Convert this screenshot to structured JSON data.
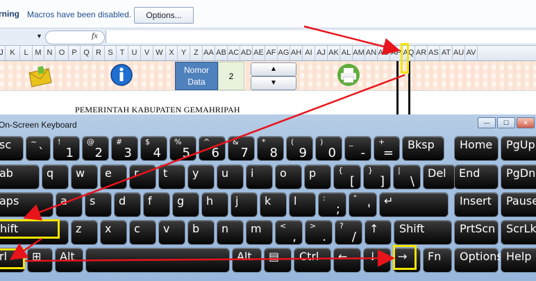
{
  "security_bar": {
    "warning_label": "rning",
    "message": "Macros have been disabled.",
    "options_button": "Options..."
  },
  "formula_bar": {
    "fx_label": "fx",
    "dropdown_glyph": "▼"
  },
  "columns": [
    "J",
    "K",
    "L",
    "M",
    "N",
    "O",
    "P",
    "Q",
    "R",
    "S",
    "T",
    "U",
    "V",
    "W",
    "X",
    "Y",
    "Z",
    "AA",
    "AB",
    "AC",
    "AD",
    "AE",
    "AF",
    "AG",
    "AH",
    "AI",
    "AJ",
    "AK",
    "AL",
    "AM",
    "AN",
    "AO",
    "AP",
    "AQ",
    "AR",
    "AS",
    "AT",
    "AU",
    "AV"
  ],
  "sheet": {
    "nomor_label_line1": "Nomor",
    "nomor_label_line2": "Data",
    "nomor_value": "2",
    "spin_up": "▲",
    "spin_down": "▼",
    "gov_text": "PEMERINTAH KABUPATEN GEMAHRIPAH"
  },
  "osk": {
    "title": "On-Screen Keyboard",
    "win_min": "—",
    "win_max": "☐",
    "win_close": "✕",
    "rows": [
      [
        {
          "id": "esc",
          "label": "sc"
        },
        {
          "id": "tilde",
          "top": "~",
          "bottom": "`"
        },
        {
          "id": "k1",
          "top": "!",
          "bottom": "1"
        },
        {
          "id": "k2",
          "top": "@",
          "bottom": "2"
        },
        {
          "id": "k3",
          "top": "#",
          "bottom": "3"
        },
        {
          "id": "k4",
          "top": "$",
          "bottom": "4"
        },
        {
          "id": "k5",
          "top": "%",
          "bottom": "5"
        },
        {
          "id": "k6",
          "top": "^",
          "bottom": "6"
        },
        {
          "id": "k7",
          "top": "&",
          "bottom": "7"
        },
        {
          "id": "k8",
          "top": "*",
          "bottom": "8"
        },
        {
          "id": "k9",
          "top": "(",
          "bottom": "9"
        },
        {
          "id": "k0",
          "top": ")",
          "bottom": "0"
        },
        {
          "id": "minus",
          "top": "_",
          "bottom": "-"
        },
        {
          "id": "equal",
          "top": "+",
          "bottom": "="
        },
        {
          "id": "bksp",
          "label": "Bksp"
        },
        {
          "id": "home",
          "label": "Home"
        },
        {
          "id": "pgup",
          "label": "PgUp"
        }
      ],
      [
        {
          "id": "tab",
          "label": "ab"
        },
        {
          "id": "q",
          "label": "q"
        },
        {
          "id": "w",
          "label": "w"
        },
        {
          "id": "e",
          "label": "e"
        },
        {
          "id": "r",
          "label": "r"
        },
        {
          "id": "t",
          "label": "t"
        },
        {
          "id": "y",
          "label": "y"
        },
        {
          "id": "u",
          "label": "u"
        },
        {
          "id": "i",
          "label": "i"
        },
        {
          "id": "o",
          "label": "o"
        },
        {
          "id": "p",
          "label": "p"
        },
        {
          "id": "lbrace",
          "top": "{",
          "bottom": "["
        },
        {
          "id": "rbrace",
          "top": "}",
          "bottom": "]"
        },
        {
          "id": "pipe",
          "top": "|",
          "bottom": "\\"
        },
        {
          "id": "del",
          "label": "Del"
        },
        {
          "id": "end",
          "label": "End"
        },
        {
          "id": "pgdn",
          "label": "PgDn"
        }
      ],
      [
        {
          "id": "caps",
          "label": "aps"
        },
        {
          "id": "a",
          "label": "a"
        },
        {
          "id": "s",
          "label": "s"
        },
        {
          "id": "d",
          "label": "d"
        },
        {
          "id": "f",
          "label": "f"
        },
        {
          "id": "g",
          "label": "g"
        },
        {
          "id": "h",
          "label": "h"
        },
        {
          "id": "j",
          "label": "j"
        },
        {
          "id": "k",
          "label": "k"
        },
        {
          "id": "l",
          "label": "l"
        },
        {
          "id": "semicolon",
          "top": ":",
          "bottom": ";"
        },
        {
          "id": "quote",
          "top": "\"",
          "bottom": "'"
        },
        {
          "id": "enter",
          "label": "↵"
        },
        {
          "id": "insert",
          "label": "Insert"
        },
        {
          "id": "pause",
          "label": "Pause"
        }
      ],
      [
        {
          "id": "lshift",
          "label": "hift"
        },
        {
          "id": "z",
          "label": "z"
        },
        {
          "id": "x",
          "label": "x"
        },
        {
          "id": "c",
          "label": "c"
        },
        {
          "id": "v",
          "label": "v"
        },
        {
          "id": "b",
          "label": "b"
        },
        {
          "id": "n",
          "label": "n"
        },
        {
          "id": "m",
          "label": "m"
        },
        {
          "id": "comma",
          "top": "<",
          "bottom": ","
        },
        {
          "id": "period",
          "top": ">",
          "bottom": "."
        },
        {
          "id": "slash",
          "top": "?",
          "bottom": "/"
        },
        {
          "id": "up",
          "label": "↑"
        },
        {
          "id": "rshift",
          "label": "Shift"
        },
        {
          "id": "prtscn",
          "label": "PrtScn"
        },
        {
          "id": "scrlk",
          "label": "ScrLk"
        }
      ],
      [
        {
          "id": "lctrl",
          "label": "rl"
        },
        {
          "id": "win",
          "label": "⊞"
        },
        {
          "id": "lalt",
          "label": "Alt"
        },
        {
          "id": "space",
          "label": ""
        },
        {
          "id": "ralt",
          "label": "Alt"
        },
        {
          "id": "menu",
          "label": "▤"
        },
        {
          "id": "rctrl",
          "label": "Ctrl"
        },
        {
          "id": "left",
          "label": "←"
        },
        {
          "id": "down",
          "label": "↓"
        },
        {
          "id": "right",
          "label": "→"
        },
        {
          "id": "fn",
          "label": "Fn"
        },
        {
          "id": "options",
          "label": "Options"
        },
        {
          "id": "help",
          "label": "Help"
        }
      ]
    ]
  },
  "colors": {
    "annotation_arrow": "#e8141b",
    "highlight_box": "#f4e400",
    "nomor_blue": "#4f81bd"
  }
}
